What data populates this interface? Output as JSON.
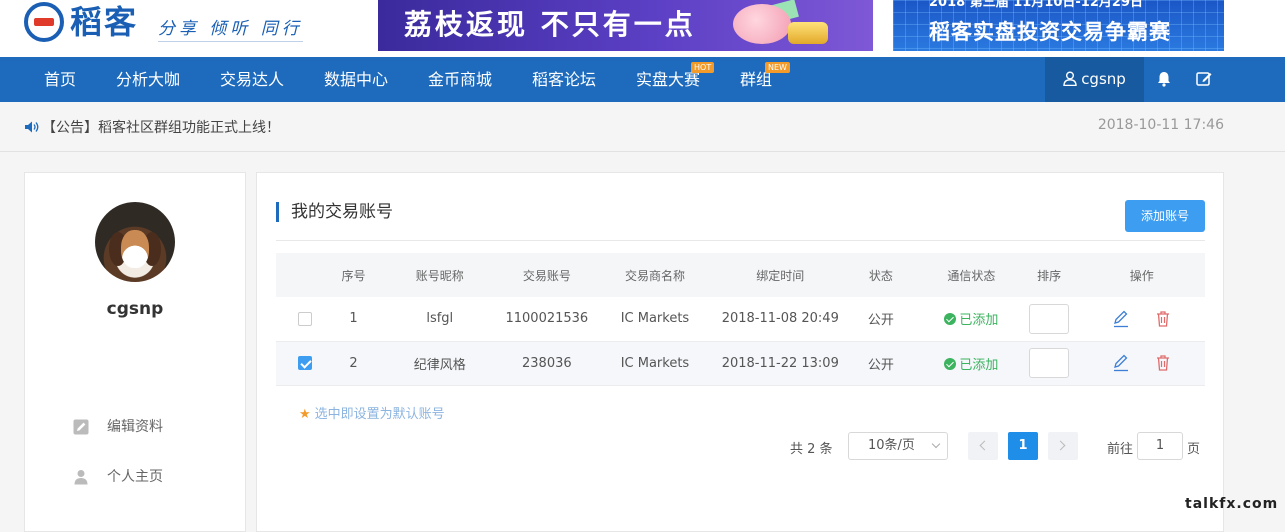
{
  "brand": {
    "name": "稻客",
    "slogan": "分享 倾听 同行"
  },
  "ads": {
    "left_text": "荔枝返现 不只有一点",
    "right_line1": "2018 第三届 11月10日-12月29日",
    "right_line2": "稻客实盘投资交易争霸赛"
  },
  "nav": {
    "items": [
      "首页",
      "分析大咖",
      "交易达人",
      "数据中心",
      "金币商城",
      "稻客论坛",
      "实盘大赛",
      "群组"
    ],
    "badge_hot": "HOT",
    "badge_new": "NEW",
    "user": "cgsnp"
  },
  "notice": {
    "text": "【公告】稻客社区群组功能正式上线！",
    "time": "2018-10-11 17:46"
  },
  "sidebar": {
    "username": "cgsnp",
    "links": [
      "编辑资料",
      "个人主页"
    ]
  },
  "main": {
    "title": "我的交易账号",
    "add_button": "添加账号",
    "columns": [
      "序号",
      "账号昵称",
      "交易账号",
      "交易商名称",
      "绑定时间",
      "状态",
      "通信状态",
      "排序",
      "操作"
    ],
    "rows": [
      {
        "checked": false,
        "no": "1",
        "nickname": "lsfgl",
        "account": "1100021536",
        "broker": "IC Markets",
        "bind_time": "2018-11-08 20:49",
        "status": "公开",
        "comm": "已添加"
      },
      {
        "checked": true,
        "no": "2",
        "nickname": "纪律风格",
        "account": "238036",
        "broker": "IC Markets",
        "bind_time": "2018-11-22 13:09",
        "status": "公开",
        "comm": "已添加"
      }
    ],
    "hint": "选中即设置为默认账号",
    "pager": {
      "total": "共 2 条",
      "page_size": "10条/页",
      "current": "1",
      "goto_label": "前往",
      "goto_value": "1",
      "page_label": "页"
    }
  },
  "watermark": "talkfx.com",
  "colors": {
    "nav_bg": "#1e6bbd",
    "accent": "#3d9df0",
    "ok": "#3cb35f",
    "danger": "#e06b6b"
  }
}
